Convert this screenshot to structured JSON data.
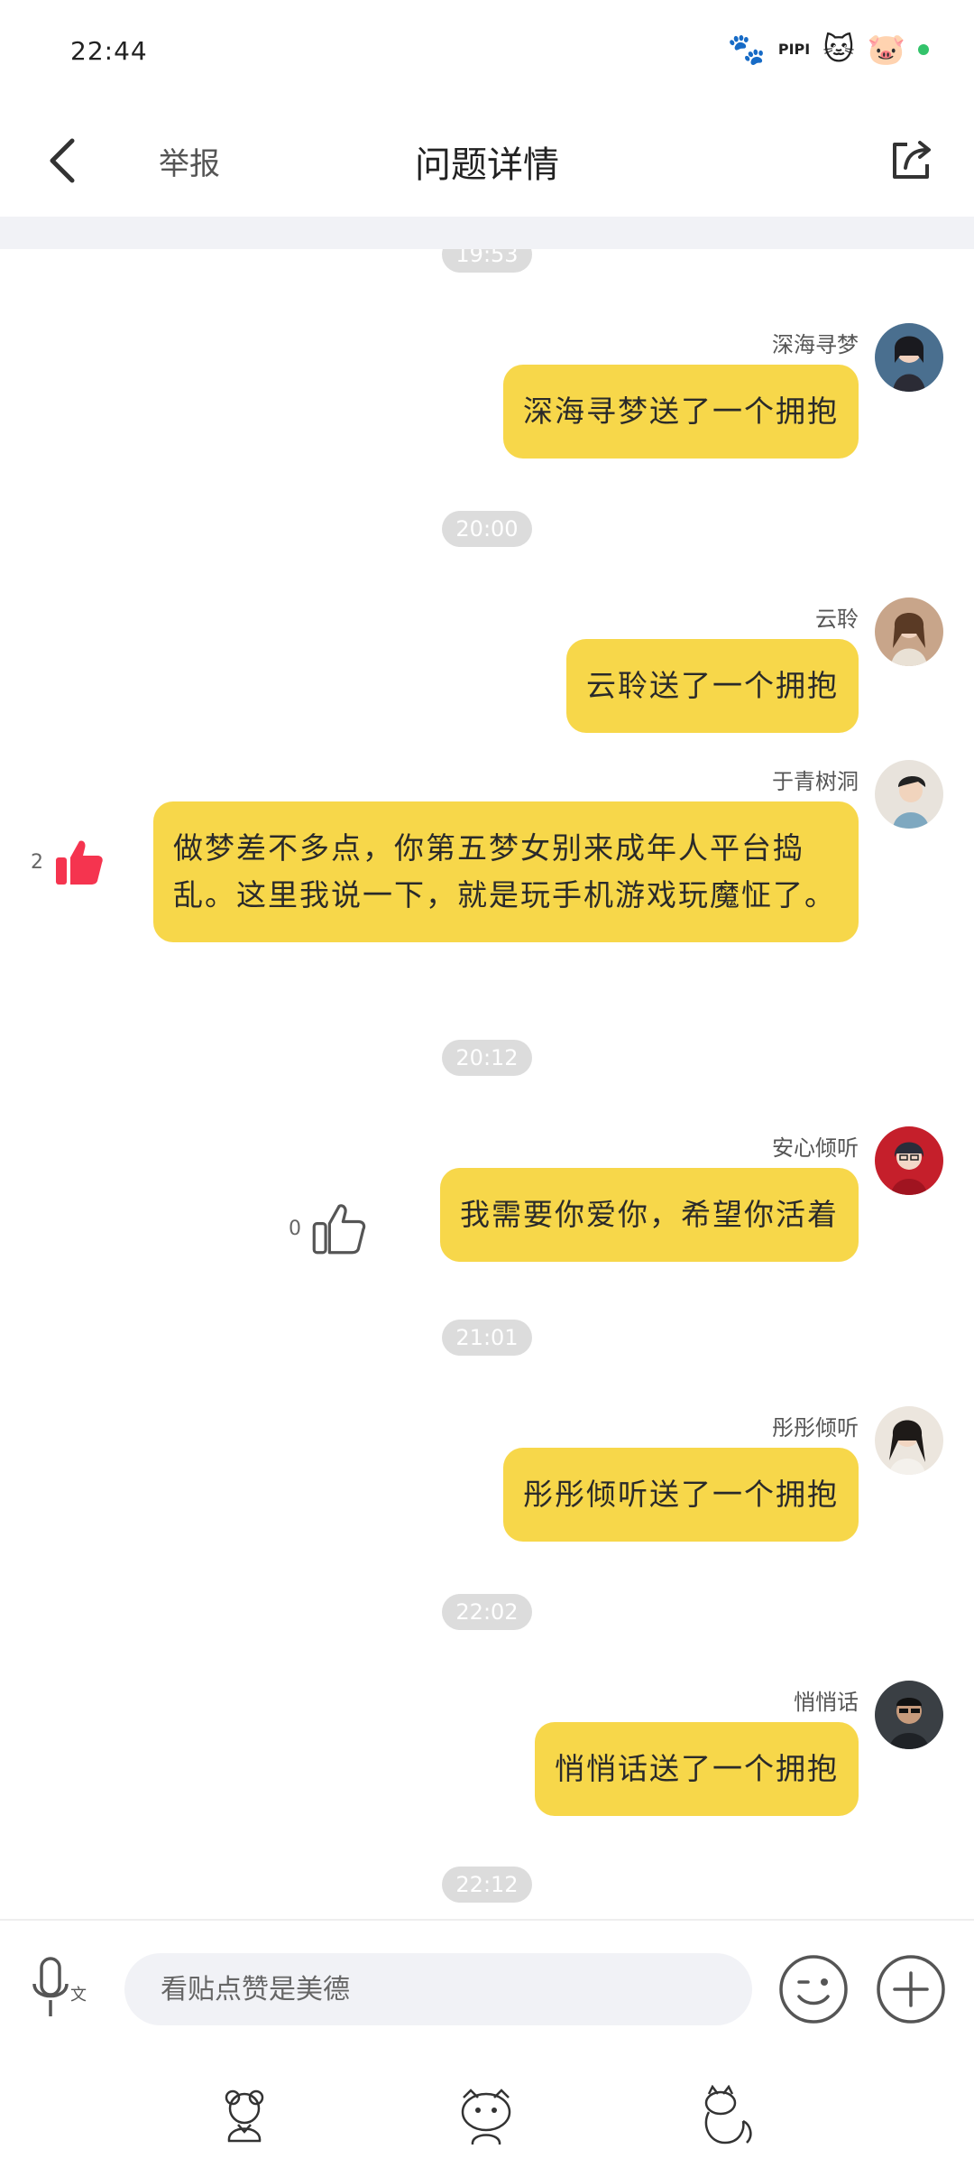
{
  "status_bar": {
    "time": "22:44",
    "icons": [
      "paw-icon",
      "pipi-icon",
      "cat-icon",
      "pig-icon"
    ],
    "pipi_label": "PIPI"
  },
  "header": {
    "report_label": "举报",
    "title": "问题详情",
    "back_icon": "chevron-left-icon",
    "share_icon": "share-icon"
  },
  "messages": [
    {
      "sender": "深海寻梦",
      "text": "深海寻梦送了一个拥抱"
    },
    {
      "time": "20:00"
    },
    {
      "sender": "云聆",
      "text": "云聆送了一个拥抱"
    },
    {
      "sender": "于青树洞",
      "text": "做梦差不多点，你第五梦女别来成年人平台捣乱。这里我说一下，就是玩手机游戏玩魔怔了。",
      "likes": "2",
      "liked": true
    },
    {
      "time": "20:12"
    },
    {
      "sender": "安心倾听",
      "text": "我需要你爱你，希望你活着",
      "likes": "0",
      "liked": false
    },
    {
      "time": "21:01"
    },
    {
      "sender": "彤彤倾听",
      "text": "彤彤倾听送了一个拥抱"
    },
    {
      "time": "22:02"
    },
    {
      "sender": "悄悄话",
      "text": "悄悄话送了一个拥抱"
    },
    {
      "time": "22:12"
    }
  ],
  "top_partial_time": "19:53",
  "input": {
    "placeholder": "看贴点赞是美德"
  },
  "colors": {
    "bubble": "#f7d74a",
    "like_active": "#f5344f",
    "time_pill": "#dcdcdc"
  }
}
